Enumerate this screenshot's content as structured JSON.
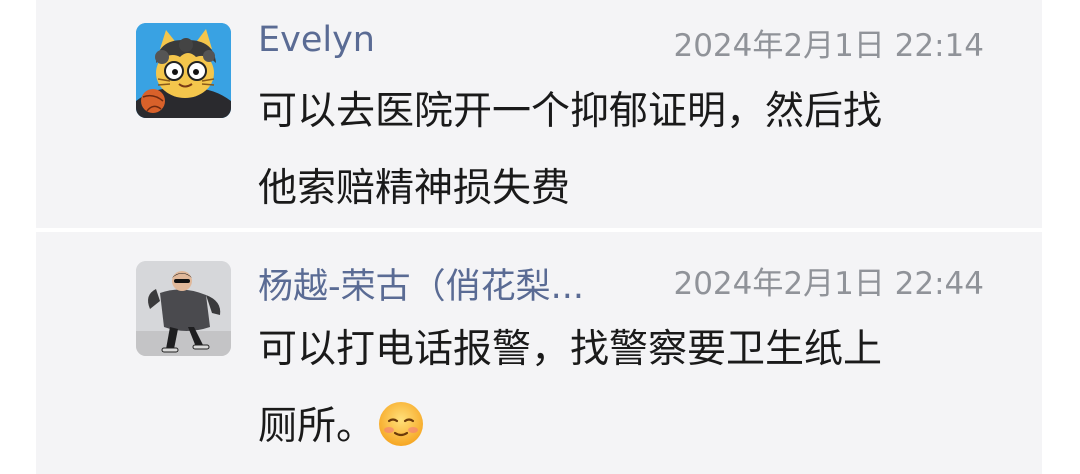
{
  "comments": [
    {
      "author": "Evelyn",
      "timestamp": "2024年2月1日 22:14",
      "lines": [
        "可以去医院开一个抑郁证明，然后找",
        "他索赔精神损失费"
      ],
      "avatar_icon": "cartoon-cat-avatar"
    },
    {
      "author": "杨越-荣古（俏花梨...",
      "timestamp": "2024年2月1日 22:44",
      "lines": [
        "可以打电话报警，找警察要卫生纸上",
        "厕所。"
      ],
      "emoji_icon": "pleading-face-emoji",
      "avatar_icon": "dancing-man-avatar"
    }
  ],
  "reply_icon": "comment-bubble-icon",
  "colors": {
    "card_bg": "#f4f4f6",
    "name": "#5a6b94",
    "timestamp": "#909399",
    "text": "#1a1a1a"
  }
}
